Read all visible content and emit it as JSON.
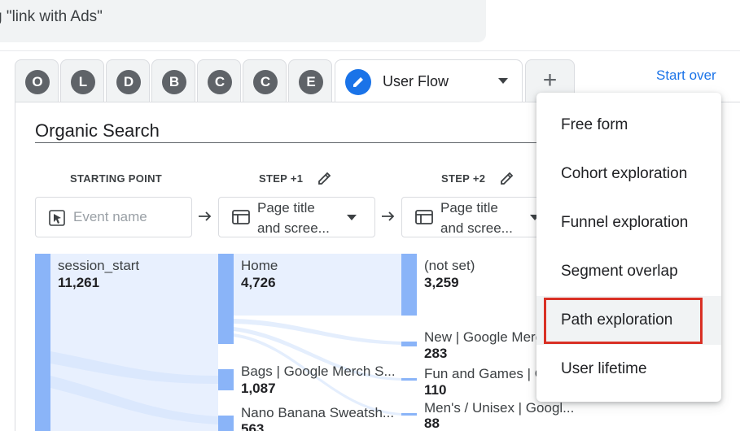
{
  "search": {
    "text": "g \"link with Ads\""
  },
  "tabs": {
    "letters": [
      "O",
      "L",
      "D",
      "B",
      "C",
      "C",
      "E"
    ],
    "active": {
      "label": "User Flow",
      "icon": "pencil-icon"
    },
    "add_label": "+"
  },
  "toolbar": {
    "start_over": "Start over"
  },
  "segment": {
    "title": "Organic Search"
  },
  "columns": {
    "starting": {
      "heading": "STARTING POINT",
      "placeholder": "Event name"
    },
    "step1": {
      "heading": "STEP +1",
      "dropdown_line1": "Page title",
      "dropdown_line2": "and scree..."
    },
    "step2": {
      "heading": "STEP +2",
      "dropdown_line1": "Page title",
      "dropdown_line2": "and scree..."
    }
  },
  "nodes": {
    "start": [
      {
        "label": "session_start",
        "value": "11,261"
      }
    ],
    "step1": [
      {
        "label": "Home",
        "value": "4,726"
      },
      {
        "label": "Bags | Google Merch S...",
        "value": "1,087"
      },
      {
        "label": "Nano Banana Sweatsh...",
        "value": "563"
      }
    ],
    "step2": [
      {
        "label": "(not set)",
        "value": "3,259"
      },
      {
        "label": "New | Google Merc",
        "value": "283"
      },
      {
        "label": "Fun and Games | G",
        "value": "110"
      },
      {
        "label": "Men's / Unisex | Googl...",
        "value": "88"
      }
    ]
  },
  "menu": {
    "items": [
      {
        "label": "Free form"
      },
      {
        "label": "Cohort exploration"
      },
      {
        "label": "Funnel exploration"
      },
      {
        "label": "Segment overlap"
      },
      {
        "label": "Path exploration"
      },
      {
        "label": "User lifetime"
      }
    ],
    "highlighted_index": 4
  },
  "colors": {
    "accent": "#1a73e8",
    "flow_bar": "#8ab4f8",
    "flow_band": "#e8f0fe",
    "highlight": "#d93025"
  }
}
